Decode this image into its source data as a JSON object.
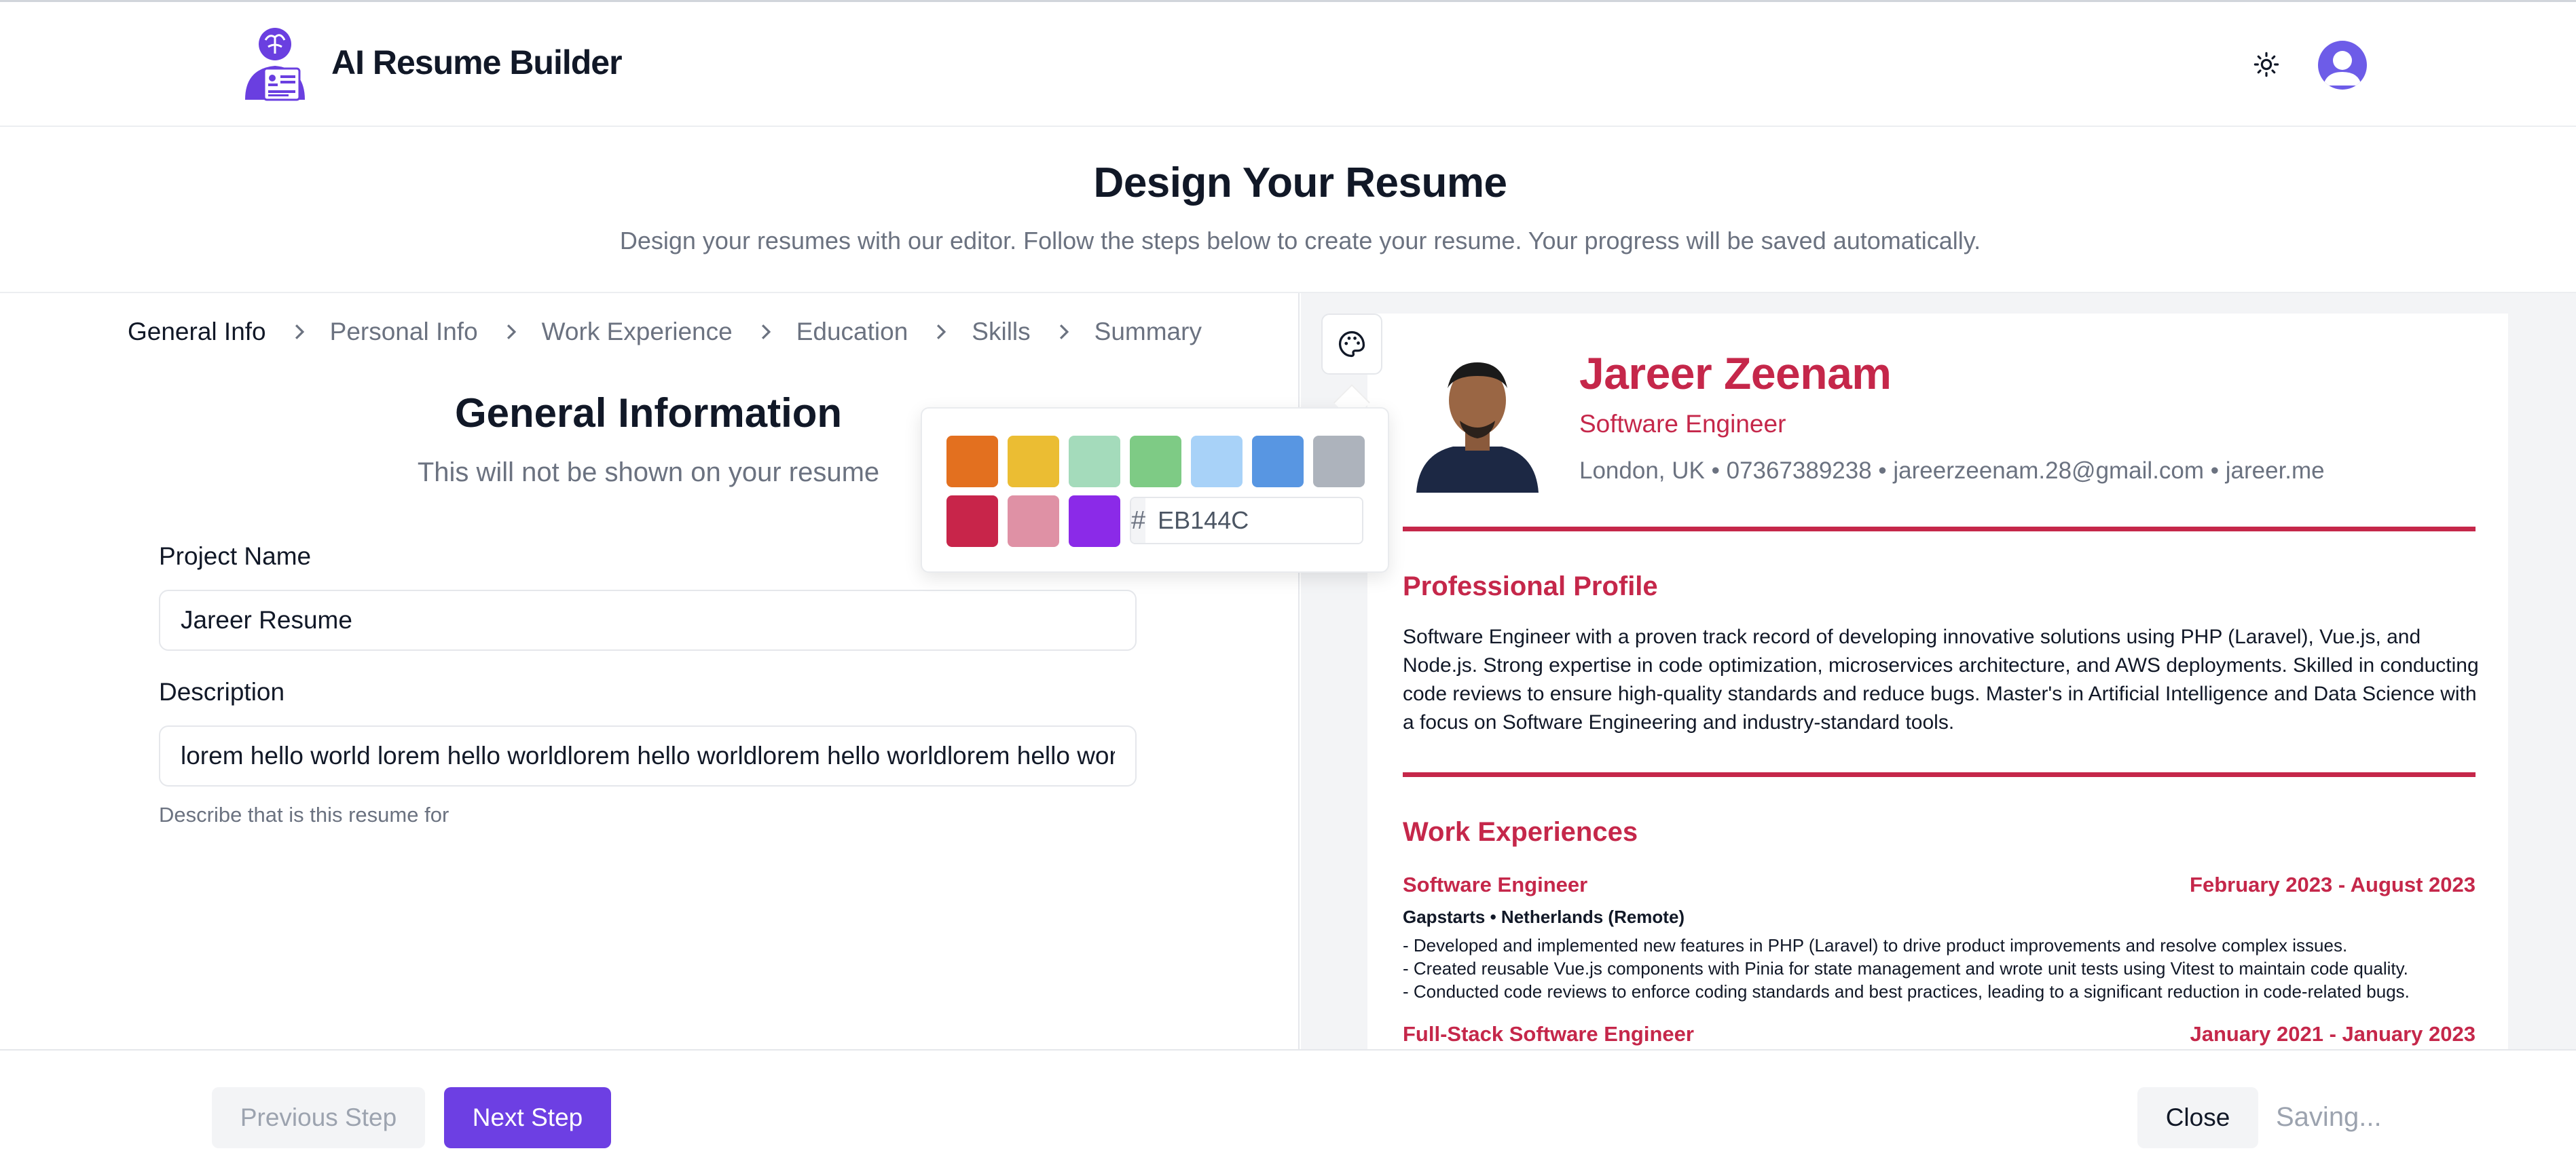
{
  "app": {
    "title": "AI Resume Builder"
  },
  "page": {
    "title": "Design Your Resume",
    "subtitle": "Design your resumes with our editor. Follow the steps below to create your resume. Your progress will be saved automatically."
  },
  "steps": [
    {
      "label": "General Info",
      "active": true
    },
    {
      "label": "Personal Info",
      "active": false
    },
    {
      "label": "Work Experience",
      "active": false
    },
    {
      "label": "Education",
      "active": false
    },
    {
      "label": "Skills",
      "active": false
    },
    {
      "label": "Summary",
      "active": false
    }
  ],
  "form": {
    "title": "General Information",
    "subtitle": "This will not be shown on your resume",
    "project_name": {
      "label": "Project Name",
      "value": "Jareer Resume"
    },
    "description": {
      "label": "Description",
      "value": "lorem hello world lorem hello worldlorem hello worldlorem hello worldlorem hello world",
      "hint": "Describe that is this resume for"
    }
  },
  "color_picker": {
    "swatches": [
      "#e3701f",
      "#ebbd33",
      "#a4dbbb",
      "#7ecb85",
      "#a8d2f8",
      "#5896e2",
      "#adb3bc",
      "#c8254a",
      "#df91a5",
      "#8b2ae8"
    ],
    "hash_symbol": "#",
    "hex_value": "EB144C"
  },
  "resume": {
    "name": "Jareer Zeenam",
    "role": "Software Engineer",
    "contact": "London, UK • 07367389238 • jareerzeenam.28@gmail.com • jareer.me",
    "accent_color": "#c5274a",
    "profile_title": "Professional Profile",
    "profile_text": "Software Engineer with a proven track record of developing innovative solutions using PHP (Laravel), Vue.js, and Node.js. Strong expertise in code optimization, microservices architecture, and AWS deployments. Skilled in conducting code reviews to ensure high-quality standards and reduce bugs. Master's in Artificial Intelligence and Data Science with a focus on Software Engineering and industry-standard tools.",
    "work_title": "Work Experiences",
    "jobs": [
      {
        "title": "Software Engineer",
        "dates": "February 2023 - August 2023",
        "company": "Gapstarts • Netherlands (Remote)",
        "bullets": [
          "- Developed and implemented new features in PHP (Laravel) to drive product improvements and resolve complex issues.",
          "- Created reusable Vue.js components with Pinia for state management and wrote unit tests using Vitest to maintain code quality.",
          "- Conducted code reviews to enforce coding standards and best practices, leading to a significant reduction in code-related bugs."
        ]
      },
      {
        "title": "Full-Stack Software Engineer",
        "dates": "January 2021 - January 2023"
      }
    ]
  },
  "footer": {
    "prev_label": "Previous Step",
    "next_label": "Next Step",
    "close_label": "Close",
    "status": "Saving..."
  },
  "icons": {
    "logo": "robot-resume-logo",
    "theme": "sun-icon",
    "avatar": "user-avatar-icon",
    "palette": "palette-icon",
    "separator": "chevron-right-icon"
  }
}
